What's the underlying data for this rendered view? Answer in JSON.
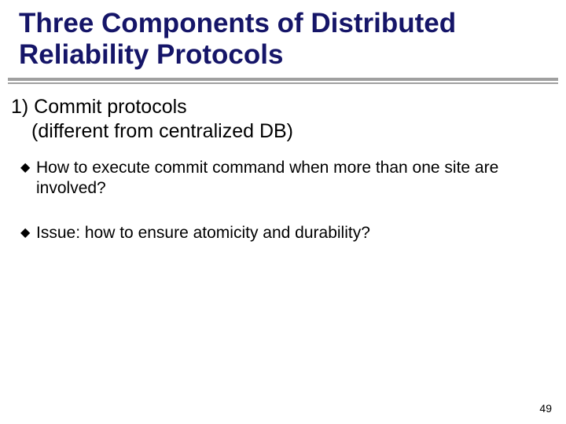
{
  "slide": {
    "title": "Three Components of Distributed Reliability Protocols",
    "section": {
      "heading_line1": "1) Commit protocols",
      "heading_line2": "(different from centralized DB)",
      "bullets": [
        "How to execute commit command when more than one site are involved?",
        "Issue: how to ensure atomicity and durability?"
      ]
    },
    "page_number": "49"
  }
}
